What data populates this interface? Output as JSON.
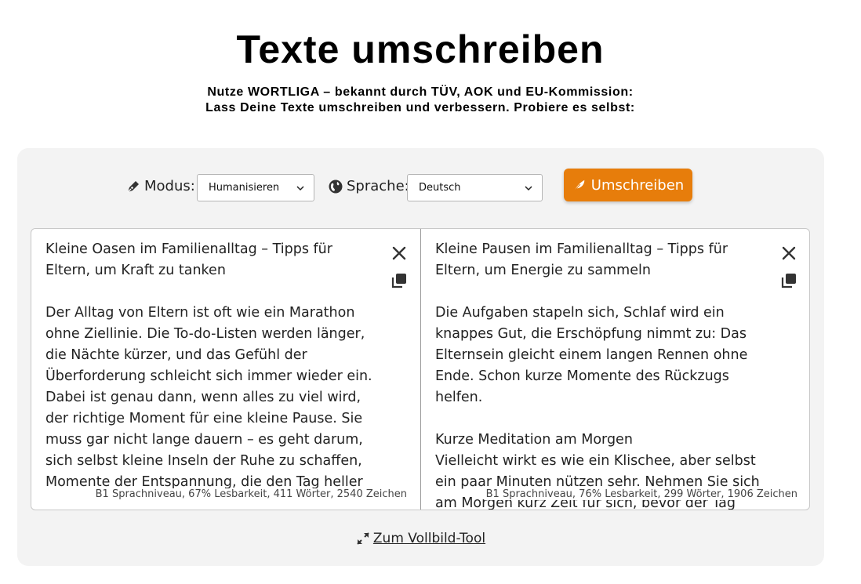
{
  "header": {
    "title": "Texte umschreiben",
    "subtitle_line1": "Nutze WORTLIGA – bekannt durch TÜV, AOK und EU-Kommission:",
    "subtitle_line2": "Lass Deine Texte umschreiben und verbessern. Probiere es selbst:"
  },
  "controls": {
    "mode_label": "Modus:",
    "mode_value": "Humanisieren",
    "language_label": "Sprache:",
    "language_value": "Deutsch",
    "rewrite_button": "Umschreiben",
    "accent_color": "#e77d0b"
  },
  "editors": {
    "left": {
      "text": "Kleine Oasen im Familienalltag – Tipps für Eltern, um Kraft zu tanken\n\nDer Alltag von Eltern ist oft wie ein Marathon ohne Ziellinie. Die To-do-Listen werden länger, die Nächte kürzer, und das Gefühl der Überforderung schleicht sich immer wieder ein. Dabei ist genau dann, wenn alles zu viel wird, der richtige Moment für eine kleine Pause. Sie muss gar nicht lange dauern – es geht darum, sich selbst kleine Inseln der Ruhe zu schaffen, Momente der Entspannung, die den Tag heller und leichter machen.",
      "stats": "B1 Sprachniveau, 67% Lesbarkeit, 411 Wörter, 2540 Zeichen"
    },
    "right": {
      "text": "Kleine Pausen im Familienalltag – Tipps für Eltern, um Energie zu sammeln\n\nDie Aufgaben stapeln sich, Schlaf wird ein knappes Gut, die Erschöpfung nimmt zu: Das Elternsein gleicht einem langen Rennen ohne Ende. Schon kurze Momente des Rückzugs helfen.\n\nKurze Meditation am Morgen\nVielleicht wirkt es wie ein Klischee, aber selbst ein paar Minuten nützen sehr. Nehmen Sie sich am Morgen kurz Zeit für sich, bevor der Tag beginnt. Schon",
      "stats": "B1 Sprachniveau, 76% Lesbarkeit, 299 Wörter, 1906 Zeichen"
    },
    "icons": [
      "close-icon",
      "copy-icon"
    ]
  },
  "footer": {
    "fullscreen_link": "Zum Vollbild-Tool",
    "icon": "expand-icon"
  }
}
